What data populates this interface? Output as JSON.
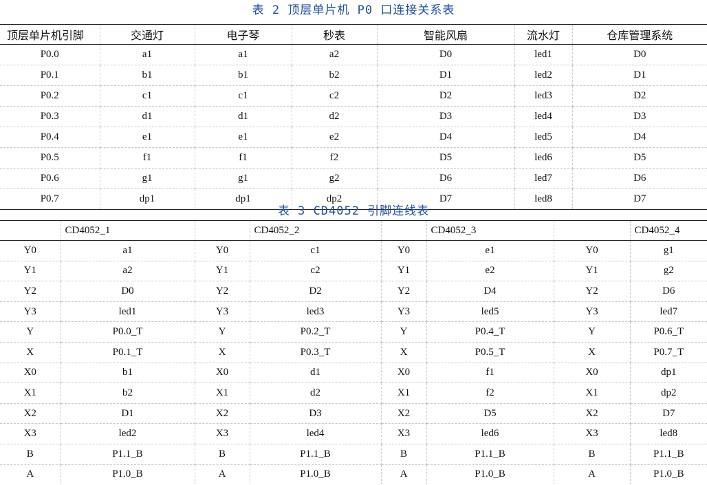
{
  "table2": {
    "caption": "表 2 顶层单片机 P0 口连接关系表",
    "headers": [
      "顶层单片机引脚",
      "交通灯",
      "电子琴",
      "秒表",
      "智能风扇",
      "流水灯",
      "仓库管理系统"
    ],
    "rows": [
      [
        "P0.0",
        "a1",
        "a1",
        "a2",
        "D0",
        "led1",
        "D0"
      ],
      [
        "P0.1",
        "b1",
        "b1",
        "b2",
        "D1",
        "led2",
        "D1"
      ],
      [
        "P0.2",
        "c1",
        "c1",
        "c2",
        "D2",
        "led3",
        "D2"
      ],
      [
        "P0.3",
        "d1",
        "d1",
        "d2",
        "D3",
        "led4",
        "D3"
      ],
      [
        "P0.4",
        "e1",
        "e1",
        "e2",
        "D4",
        "led5",
        "D4"
      ],
      [
        "P0.5",
        "f1",
        "f1",
        "f2",
        "D5",
        "led6",
        "D5"
      ],
      [
        "P0.6",
        "g1",
        "g1",
        "g2",
        "D6",
        "led7",
        "D6"
      ],
      [
        "P0.7",
        "dp1",
        "dp1",
        "dp2",
        "D7",
        "led8",
        "D7"
      ]
    ]
  },
  "table3": {
    "caption": "表 3 CD4052 引脚连线表",
    "headers": [
      "",
      "CD4052_1",
      "",
      "CD4052_2",
      "",
      "CD4052_3",
      "",
      "CD4052_4"
    ],
    "rows": [
      [
        "Y0",
        "a1",
        "Y0",
        "c1",
        "Y0",
        "e1",
        "Y0",
        "g1"
      ],
      [
        "Y1",
        "a2",
        "Y1",
        "c2",
        "Y1",
        "e2",
        "Y1",
        "g2"
      ],
      [
        "Y2",
        "D0",
        "Y2",
        "D2",
        "Y2",
        "D4",
        "Y2",
        "D6"
      ],
      [
        "Y3",
        "led1",
        "Y3",
        "led3",
        "Y3",
        "led5",
        "Y3",
        "led7"
      ],
      [
        "Y",
        "P0.0_T",
        "Y",
        "P0.2_T",
        "Y",
        "P0.4_T",
        "Y",
        "P0.6_T"
      ],
      [
        "X",
        "P0.1_T",
        "X",
        "P0.3_T",
        "X",
        "P0.5_T",
        "X",
        "P0.7_T"
      ],
      [
        "X0",
        "b1",
        "X0",
        "d1",
        "X0",
        "f1",
        "X0",
        "dp1"
      ],
      [
        "X1",
        "b2",
        "X1",
        "d2",
        "X1",
        "f2",
        "X1",
        "dp2"
      ],
      [
        "X2",
        "D1",
        "X2",
        "D3",
        "X2",
        "D5",
        "X2",
        "D7"
      ],
      [
        "X3",
        "led2",
        "X3",
        "led4",
        "X3",
        "led6",
        "X3",
        "led8"
      ],
      [
        "B",
        "P1.1_B",
        "B",
        "P1.1_B",
        "B",
        "P1.1_B",
        "B",
        "P1.1_B"
      ],
      [
        "A",
        "P1.0_B",
        "A",
        "P1.0_B",
        "A",
        "P1.0_B",
        "A",
        "P1.0_B"
      ]
    ]
  }
}
